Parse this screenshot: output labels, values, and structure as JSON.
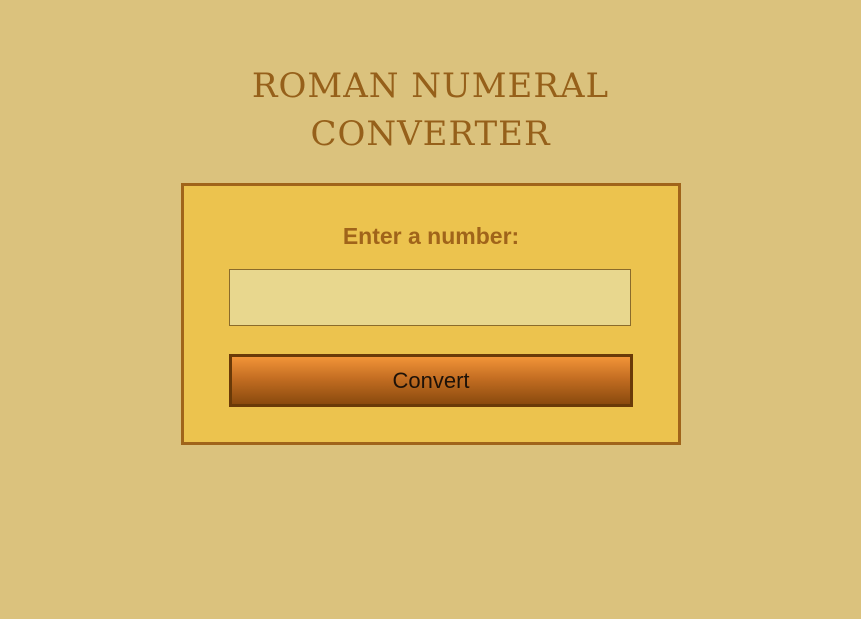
{
  "page": {
    "title_line1": "ROMAN NUMERAL",
    "title_line2": "CONVERTER"
  },
  "form": {
    "label": "Enter a number:",
    "input_value": "",
    "button_label": "Convert"
  },
  "colors": {
    "background": "#dbc27d",
    "title": "#96601a",
    "card_background": "#ecc34e",
    "card_border": "#a0641a",
    "input_background": "#e8d78e",
    "button_top": "#f29438",
    "button_bottom": "#8a4a0e"
  }
}
